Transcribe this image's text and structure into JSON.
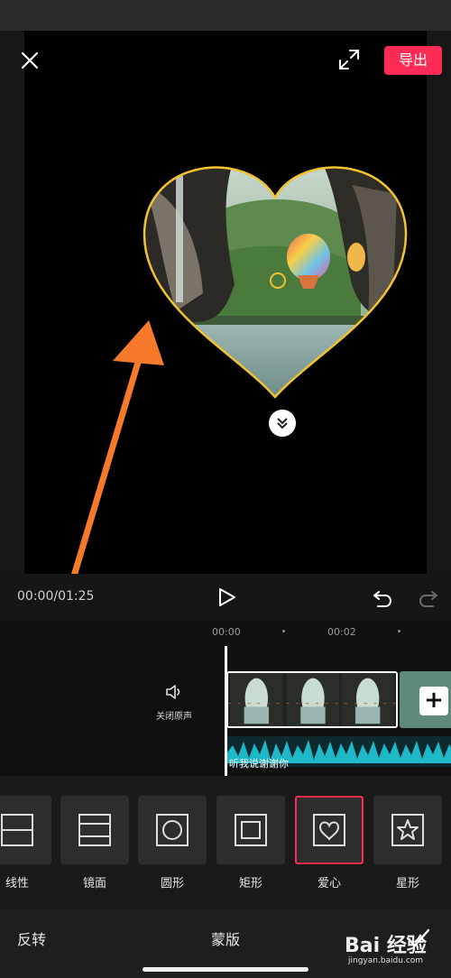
{
  "header": {
    "export_label": "导出"
  },
  "controls": {
    "timecode": "00:00/01:25"
  },
  "timeline": {
    "ruler": [
      "00:00",
      "00:02"
    ],
    "mute_label": "关闭原声",
    "audio_label": "听我说谢谢你",
    "add_symbol": "+"
  },
  "masks": {
    "selected": "爱心",
    "items": [
      {
        "label": "线性",
        "icon": "linear-mask-icon"
      },
      {
        "label": "镜面",
        "icon": "mirror-mask-icon"
      },
      {
        "label": "圆形",
        "icon": "circle-mask-icon"
      },
      {
        "label": "矩形",
        "icon": "rectangle-mask-icon"
      },
      {
        "label": "爱心",
        "icon": "heart-mask-icon"
      },
      {
        "label": "星形",
        "icon": "star-mask-icon"
      }
    ]
  },
  "footer": {
    "reverse_label": "反转",
    "title": "蒙版"
  },
  "watermark": {
    "main": "Bai 经验",
    "sub": "jingyan.baidu.com"
  },
  "colors": {
    "accent": "#fe2c55",
    "mask_outline": "#f2c230",
    "waveform": "#1fb8c9",
    "annotation_arrow": "#f77a2b"
  }
}
